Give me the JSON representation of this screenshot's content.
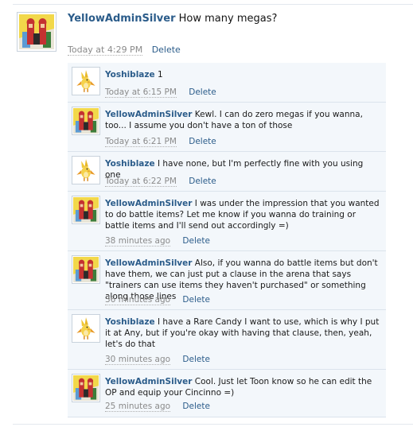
{
  "main_post": {
    "username": "YellowAdminSilver",
    "message": "How many megas?",
    "timestamp": "Today at 4:29 PM",
    "delete_label": "Delete",
    "avatar_icon": "red-character-avatar-icon"
  },
  "comments": [
    {
      "username": "Yoshiblaze",
      "message": "1",
      "timestamp": "Today at 6:15 PM",
      "delete_label": "Delete",
      "avatar_icon": "yellow-bird-avatar-icon"
    },
    {
      "username": "YellowAdminSilver",
      "message": "Kewl. I can do zero megas if you wanna, too... I assume you don't have a ton of those",
      "timestamp": "Today at 6:21 PM",
      "delete_label": "Delete",
      "avatar_icon": "red-character-avatar-icon"
    },
    {
      "username": "Yoshiblaze",
      "message": "I have none, but I'm perfectly fine with you using one",
      "timestamp": "Today at 6:22 PM",
      "delete_label": "Delete",
      "avatar_icon": "yellow-bird-avatar-icon"
    },
    {
      "username": "YellowAdminSilver",
      "message": "I was under the impression that you wanted to do battle items? Let me know if you wanna do training or battle items and I'll send out accordingly =)",
      "timestamp": "38 minutes ago",
      "delete_label": "Delete",
      "avatar_icon": "red-character-avatar-icon"
    },
    {
      "username": "YellowAdminSilver",
      "message": "Also, if you wanna do battle items but don't have them, we can just put a clause in the arena that says \"trainers can use items they haven't purchased\" or something along those lines",
      "timestamp": "36 minutes ago",
      "delete_label": "Delete",
      "avatar_icon": "red-character-avatar-icon"
    },
    {
      "username": "Yoshiblaze",
      "message": "I have a Rare Candy I want to use, which is why I put it at Any, but if you're okay with having that clause, then, yeah, let's do that",
      "timestamp": "30 minutes ago",
      "delete_label": "Delete",
      "avatar_icon": "yellow-bird-avatar-icon"
    },
    {
      "username": "YellowAdminSilver",
      "message": "Cool. Just let Toon know so he can edit the OP and equip your Cincinno =)",
      "timestamp": "25 minutes ago",
      "delete_label": "Delete",
      "avatar_icon": "red-character-avatar-icon"
    }
  ]
}
